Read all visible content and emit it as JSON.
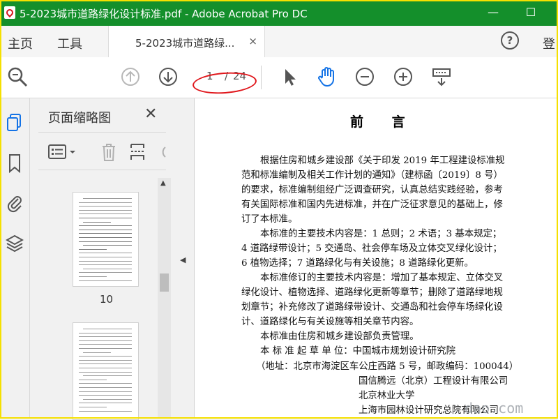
{
  "window": {
    "title": "5-2023城市道路绿化设计标准.pdf - Adobe Acrobat Pro DC",
    "minimize": "—",
    "restore": "☐"
  },
  "tabs": {
    "home": "主页",
    "tools": "工具",
    "document": "5-2023城市道路绿...",
    "close": "×",
    "help": "?",
    "signin": "登"
  },
  "toolbar": {
    "current_page": "1",
    "slash": "/",
    "total_pages": "24",
    "annotation_color": "#e0161b"
  },
  "thumbnails": {
    "title": "页面缩略图",
    "close": "✕",
    "page_label": "10"
  },
  "document": {
    "title_chars": [
      "前",
      "言"
    ],
    "lines": [
      "根据住房和城乡建设部《关于印发 2019 年工程建设标准规",
      "范和标准编制及相关工作计划的通知》（建标函〔2019〕8 号）",
      "的要求，标准编制组经广泛调查研究，认真总结实践经验，参考",
      "有关国际标准和国内先进标准，并在广泛征求意见的基础上，修",
      "订了本标准。",
      "本标准的主要技术内容是：1 总则；2 术语；3 基本规定；",
      "4 道路绿带设计；5 交通岛、社会停车场及立体交叉绿化设计；",
      "6 植物选择；7 道路绿化与有关设施；8 道路绿化更新。",
      "本标准修订的主要技术内容是：增加了基本规定、立体交叉",
      "绿化设计、植物选择、道路绿化更新等章节；删除了道路绿地规",
      "划章节；补充修改了道路绿带设计、交通岛和社会停车场绿化设",
      "计、道路绿化与有关设施等相关章节内容。",
      "本标准由住房和城乡建设部负责管理。",
      "本 标 准 起 草 单 位：中国城市规划设计研究院",
      "（地址：北京市海淀区车公庄西路 5 号，邮政编码：100044）",
      "国信腾远（北京）工程设计有限公司",
      "北京林业大学",
      "上海市园林设计研究总院有限公司"
    ]
  },
  "watermark": "dao.com",
  "colors": {
    "titlebar": "#148f2b",
    "frame": "#f5e000",
    "icon": "#555555",
    "hand_tool": "#1473e6"
  }
}
